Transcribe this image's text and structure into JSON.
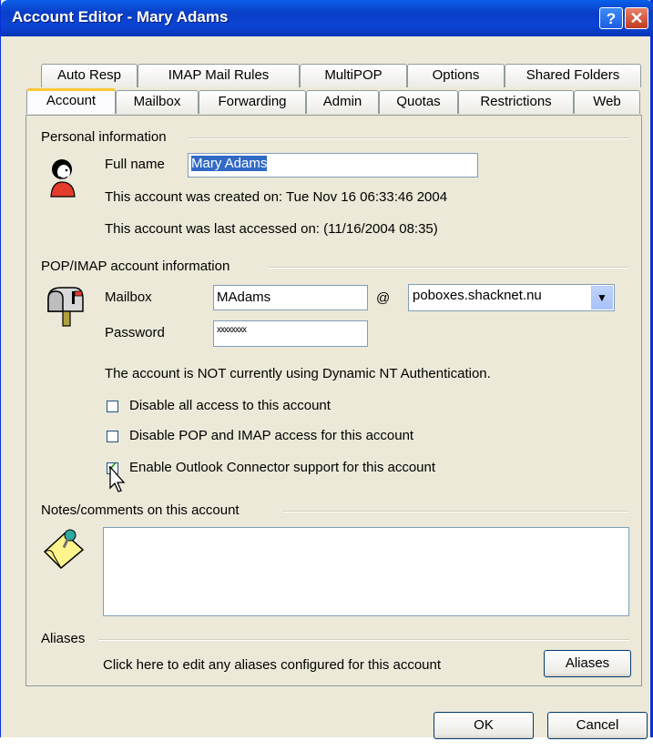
{
  "window": {
    "title": "Account Editor - Mary Adams",
    "help_label": "?",
    "close_label": "✕"
  },
  "tabs_row1": [
    "Auto Resp",
    "IMAP Mail Rules",
    "MultiPOP",
    "Options",
    "Shared Folders"
  ],
  "tabs_row2": [
    "Account",
    "Mailbox",
    "Forwarding",
    "Admin",
    "Quotas",
    "Restrictions",
    "Web"
  ],
  "personal": {
    "group_title": "Personal information",
    "fullname_label": "Full name",
    "fullname_value": "Mary Adams",
    "created_text": "This account was created on: Tue Nov 16 06:33:46 2004",
    "accessed_text": "This account was last accessed on: (11/16/2004 08:35)",
    "icon": "user-icon"
  },
  "popimap": {
    "group_title": "POP/IMAP account information",
    "mailbox_label": "Mailbox",
    "mailbox_value": "MAdams",
    "at_sign": "@",
    "domain_value": "poboxes.shacknet.nu",
    "password_label": "Password",
    "password_value": "xxxxxxxx",
    "dynamic_nt_text": "The account is NOT currently using Dynamic NT Authentication.",
    "icon": "mailbox-icon",
    "checkboxes": [
      {
        "label": "Disable all access to this account",
        "checked": false
      },
      {
        "label": "Disable POP and IMAP access for this account",
        "checked": false
      },
      {
        "label": "Enable Outlook Connector support for this account",
        "checked": true
      }
    ]
  },
  "notes": {
    "group_title": "Notes/comments on this account",
    "value": "",
    "icon": "note-pin-icon"
  },
  "aliases": {
    "group_title": "Aliases",
    "description": "Click here to edit any aliases configured for this account",
    "button_label": "Aliases"
  },
  "footer": {
    "ok_label": "OK",
    "cancel_label": "Cancel"
  },
  "colors": {
    "titlebar": "#0A3EC8",
    "dialog_bg": "#ECE9D8",
    "selection": "#316AC5"
  }
}
